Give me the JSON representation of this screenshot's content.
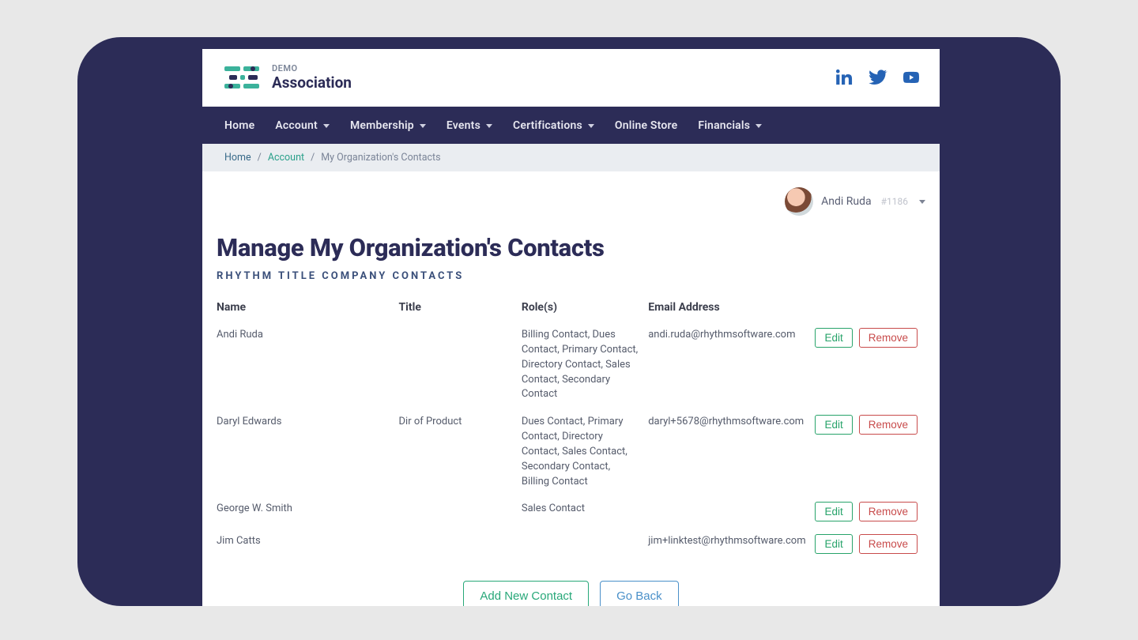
{
  "logo": {
    "top": "DEMO",
    "bottom": "Association"
  },
  "nav": {
    "items": [
      {
        "label": "Home",
        "dropdown": false
      },
      {
        "label": "Account",
        "dropdown": true
      },
      {
        "label": "Membership",
        "dropdown": true
      },
      {
        "label": "Events",
        "dropdown": true
      },
      {
        "label": "Certifications",
        "dropdown": true
      },
      {
        "label": "Online Store",
        "dropdown": false
      },
      {
        "label": "Financials",
        "dropdown": true
      }
    ]
  },
  "breadcrumb": {
    "home": "Home",
    "account": "Account",
    "current": "My Organization's Contacts",
    "sep": "/"
  },
  "user": {
    "name": "Andi Ruda",
    "id": "#1186"
  },
  "page": {
    "title": "Manage My Organization's Contacts",
    "subtitle": "RHYTHM TITLE COMPANY CONTACTS"
  },
  "table": {
    "headers": {
      "name": "Name",
      "title": "Title",
      "roles": "Role(s)",
      "email": "Email Address"
    },
    "rows": [
      {
        "name": "Andi Ruda",
        "title": "",
        "roles": "Billing Contact, Dues Contact, Primary Contact, Directory Contact, Sales Contact, Secondary Contact",
        "email": "andi.ruda@rhythmsoftware.com"
      },
      {
        "name": "Daryl Edwards",
        "title": "Dir of Product",
        "roles": "Dues Contact, Primary Contact, Directory Contact, Sales Contact, Secondary Contact, Billing Contact",
        "email": "daryl+5678@rhythmsoftware.com"
      },
      {
        "name": "George W. Smith",
        "title": "",
        "roles": "Sales Contact",
        "email": ""
      },
      {
        "name": "Jim Catts",
        "title": "",
        "roles": "",
        "email": "jim+linktest@rhythmsoftware.com"
      }
    ]
  },
  "buttons": {
    "edit": "Edit",
    "remove": "Remove",
    "add": "Add New Contact",
    "back": "Go Back"
  }
}
